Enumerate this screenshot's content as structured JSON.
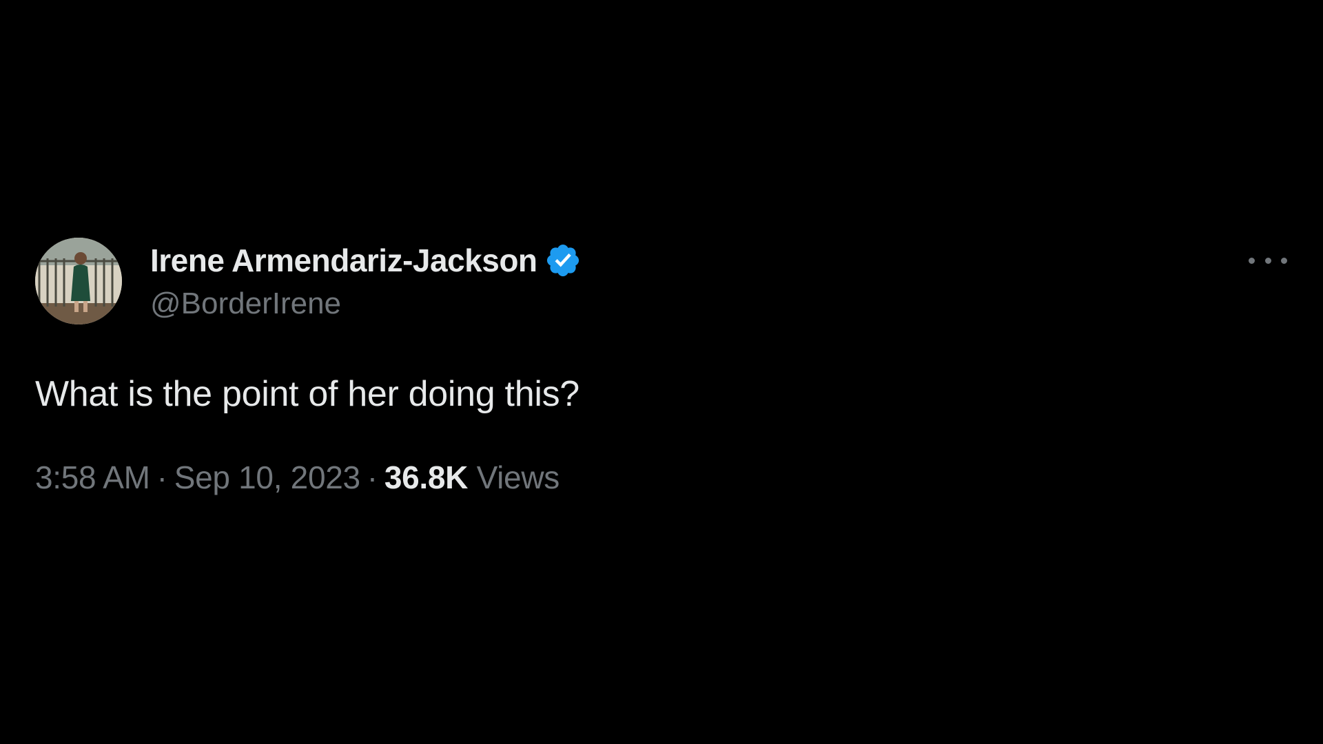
{
  "tweet": {
    "author": {
      "display_name": "Irene Armendariz-Jackson",
      "handle": "@BorderIrene",
      "verified": true,
      "avatar_icon": "profile-photo"
    },
    "text": "What is the point of her doing this?",
    "time": "3:58 AM",
    "separator": "·",
    "date": "Sep 10, 2023",
    "views_count": "36.8K",
    "views_label": "Views",
    "more_icon": "ellipsis-icon"
  },
  "colors": {
    "background": "#000000",
    "primary_text": "#e7e9ea",
    "secondary_text": "#71767b",
    "verified_blue": "#1d9bf0"
  }
}
